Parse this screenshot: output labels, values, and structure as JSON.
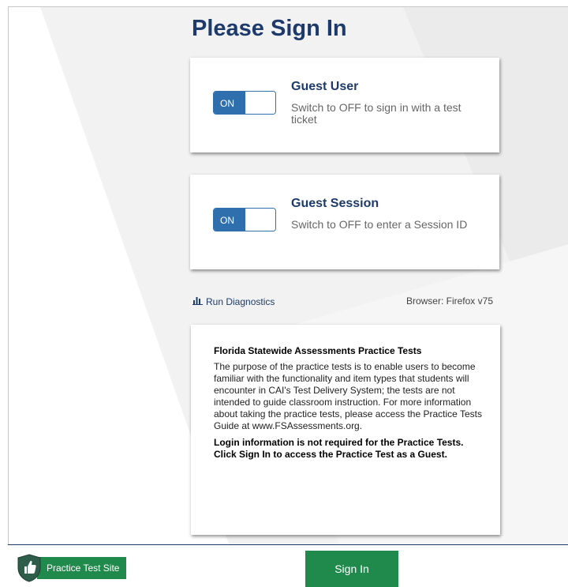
{
  "page": {
    "title": "Please Sign In"
  },
  "login_card": {
    "toggle_label": "ON",
    "title": "Guest User",
    "description": "Switch to OFF to sign in with a test ticket"
  },
  "session_card": {
    "toggle_label": "ON",
    "title": "Guest Session",
    "description": "Switch to OFF to enter a Session ID"
  },
  "diagnostics": {
    "link_label": "Run Diagnostics",
    "icon": "bar-chart-icon",
    "browser_info": "Browser: Firefox v75"
  },
  "info": {
    "title": "Florida Statewide Assessments Practice Tests",
    "text": "The purpose of the practice tests is to enable users to become familiar with the functionality and item types that students will encounter in CAI's Test Delivery System; the tests are not intended to guide classroom instruction. For more information about taking the practice tests, please access the Practice Tests Guide at www.FSAssessments.org.",
    "bold_text": "Login information is not required for the Practice Tests. Click Sign In to access the Practice Test as a Guest."
  },
  "footer": {
    "site_label": "Practice Test Site",
    "site_icon": "thumbs-up-shield-icon",
    "sign_in_label": "Sign In"
  },
  "colors": {
    "brand_navy": "#1d3a6b",
    "toggle_blue": "#2f6fae",
    "action_green": "#1f8a4c"
  }
}
